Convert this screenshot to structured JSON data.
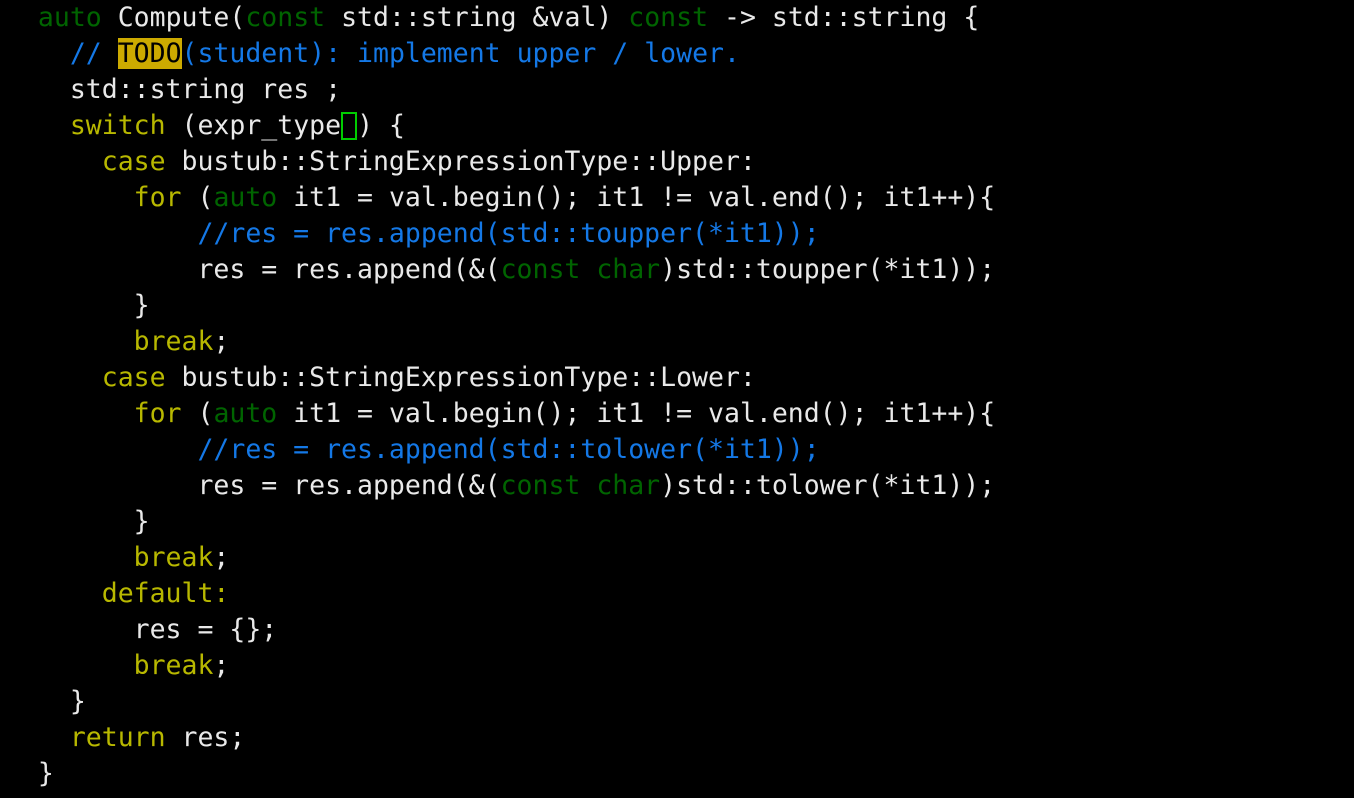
{
  "editor": {
    "language": "cpp",
    "background_color": "#000000",
    "foreground_color": "#e9e9e9",
    "colors": {
      "keyword": "#b8b800",
      "type": "#006400",
      "comment": "#1478e6",
      "plain": "#e9e9e9",
      "todo_background": "#ccaa00",
      "todo_foreground": "#000000",
      "cursor_outline": "#00cc00"
    },
    "cursor": {
      "line": 4,
      "after_text": "switch (expr_type",
      "shape": "hollow-block"
    },
    "lines": [
      {
        "n": 1,
        "indent": "  ",
        "text": "auto Compute(const std::string &val) const -> std::string {",
        "segments": [
          {
            "t": "auto",
            "c": "type"
          },
          {
            "t": " Compute(",
            "c": "plain"
          },
          {
            "t": "const",
            "c": "type"
          },
          {
            "t": " std::string &val) ",
            "c": "plain"
          },
          {
            "t": "const",
            "c": "type"
          },
          {
            "t": " -> std::string {",
            "c": "plain"
          }
        ]
      },
      {
        "n": 2,
        "indent": "    ",
        "text": "// TODO(student): implement upper / lower.",
        "segments": [
          {
            "t": "// ",
            "c": "comment"
          },
          {
            "t": "TODO",
            "c": "todo"
          },
          {
            "t": "(student): implement upper / lower.",
            "c": "comment"
          }
        ]
      },
      {
        "n": 3,
        "indent": "    ",
        "text": "std::string res ;",
        "segments": [
          {
            "t": "std::string res ;",
            "c": "plain"
          }
        ]
      },
      {
        "n": 4,
        "indent": "    ",
        "text": "switch (expr_type) {",
        "segments": [
          {
            "t": "switch",
            "c": "keyword"
          },
          {
            "t": " (expr_type",
            "c": "plain"
          },
          {
            "t": "",
            "c": "cursor"
          },
          {
            "t": ") {",
            "c": "plain"
          }
        ]
      },
      {
        "n": 5,
        "indent": "      ",
        "text": "case bustub::StringExpressionType::Upper:",
        "segments": [
          {
            "t": "case",
            "c": "keyword"
          },
          {
            "t": " bustub::StringExpressionType::Upper:",
            "c": "plain"
          }
        ]
      },
      {
        "n": 6,
        "indent": "        ",
        "text": "for (auto it1 = val.begin(); it1 != val.end(); it1++){",
        "segments": [
          {
            "t": "for",
            "c": "keyword"
          },
          {
            "t": " (",
            "c": "plain"
          },
          {
            "t": "auto",
            "c": "type"
          },
          {
            "t": " it1 = val.begin(); it1 != val.end(); it1++){",
            "c": "plain"
          }
        ]
      },
      {
        "n": 7,
        "indent": "            ",
        "text": "//res = res.append(std::toupper(*it1));",
        "segments": [
          {
            "t": "//res = res.append(std::toupper(*it1));",
            "c": "comment"
          }
        ]
      },
      {
        "n": 8,
        "indent": "            ",
        "text": "res = res.append(&(const char)std::toupper(*it1));",
        "segments": [
          {
            "t": "res = res.append(&(",
            "c": "plain"
          },
          {
            "t": "const char",
            "c": "type"
          },
          {
            "t": ")std::toupper(*it1));",
            "c": "plain"
          }
        ]
      },
      {
        "n": 9,
        "indent": "        ",
        "text": "}",
        "segments": [
          {
            "t": "}",
            "c": "plain"
          }
        ]
      },
      {
        "n": 10,
        "indent": "        ",
        "text": "break;",
        "segments": [
          {
            "t": "break",
            "c": "keyword"
          },
          {
            "t": ";",
            "c": "plain"
          }
        ]
      },
      {
        "n": 11,
        "indent": "      ",
        "text": "case bustub::StringExpressionType::Lower:",
        "segments": [
          {
            "t": "case",
            "c": "keyword"
          },
          {
            "t": " bustub::StringExpressionType::Lower:",
            "c": "plain"
          }
        ]
      },
      {
        "n": 12,
        "indent": "        ",
        "text": "for (auto it1 = val.begin(); it1 != val.end(); it1++){",
        "segments": [
          {
            "t": "for",
            "c": "keyword"
          },
          {
            "t": " (",
            "c": "plain"
          },
          {
            "t": "auto",
            "c": "type"
          },
          {
            "t": " it1 = val.begin(); it1 != val.end(); it1++){",
            "c": "plain"
          }
        ]
      },
      {
        "n": 13,
        "indent": "            ",
        "text": "//res = res.append(std::tolower(*it1));",
        "segments": [
          {
            "t": "//res = res.append(std::tolower(*it1));",
            "c": "comment"
          }
        ]
      },
      {
        "n": 14,
        "indent": "            ",
        "text": "res = res.append(&(const char)std::tolower(*it1));",
        "segments": [
          {
            "t": "res = res.append(&(",
            "c": "plain"
          },
          {
            "t": "const char",
            "c": "type"
          },
          {
            "t": ")std::tolower(*it1));",
            "c": "plain"
          }
        ]
      },
      {
        "n": 15,
        "indent": "        ",
        "text": "}",
        "segments": [
          {
            "t": "}",
            "c": "plain"
          }
        ]
      },
      {
        "n": 16,
        "indent": "        ",
        "text": "break;",
        "segments": [
          {
            "t": "break",
            "c": "keyword"
          },
          {
            "t": ";",
            "c": "plain"
          }
        ]
      },
      {
        "n": 17,
        "indent": "      ",
        "text": "default:",
        "segments": [
          {
            "t": "default:",
            "c": "keyword"
          }
        ]
      },
      {
        "n": 18,
        "indent": "        ",
        "text": "res = {};",
        "segments": [
          {
            "t": "res = {};",
            "c": "plain"
          }
        ]
      },
      {
        "n": 19,
        "indent": "        ",
        "text": "break;",
        "segments": [
          {
            "t": "break",
            "c": "keyword"
          },
          {
            "t": ";",
            "c": "plain"
          }
        ]
      },
      {
        "n": 20,
        "indent": "    ",
        "text": "}",
        "segments": [
          {
            "t": "}",
            "c": "plain"
          }
        ]
      },
      {
        "n": 21,
        "indent": "    ",
        "text": "return res;",
        "segments": [
          {
            "t": "return",
            "c": "keyword"
          },
          {
            "t": " res;",
            "c": "plain"
          }
        ]
      },
      {
        "n": 22,
        "indent": "  ",
        "text": "}",
        "segments": [
          {
            "t": "}",
            "c": "plain"
          }
        ]
      }
    ]
  }
}
